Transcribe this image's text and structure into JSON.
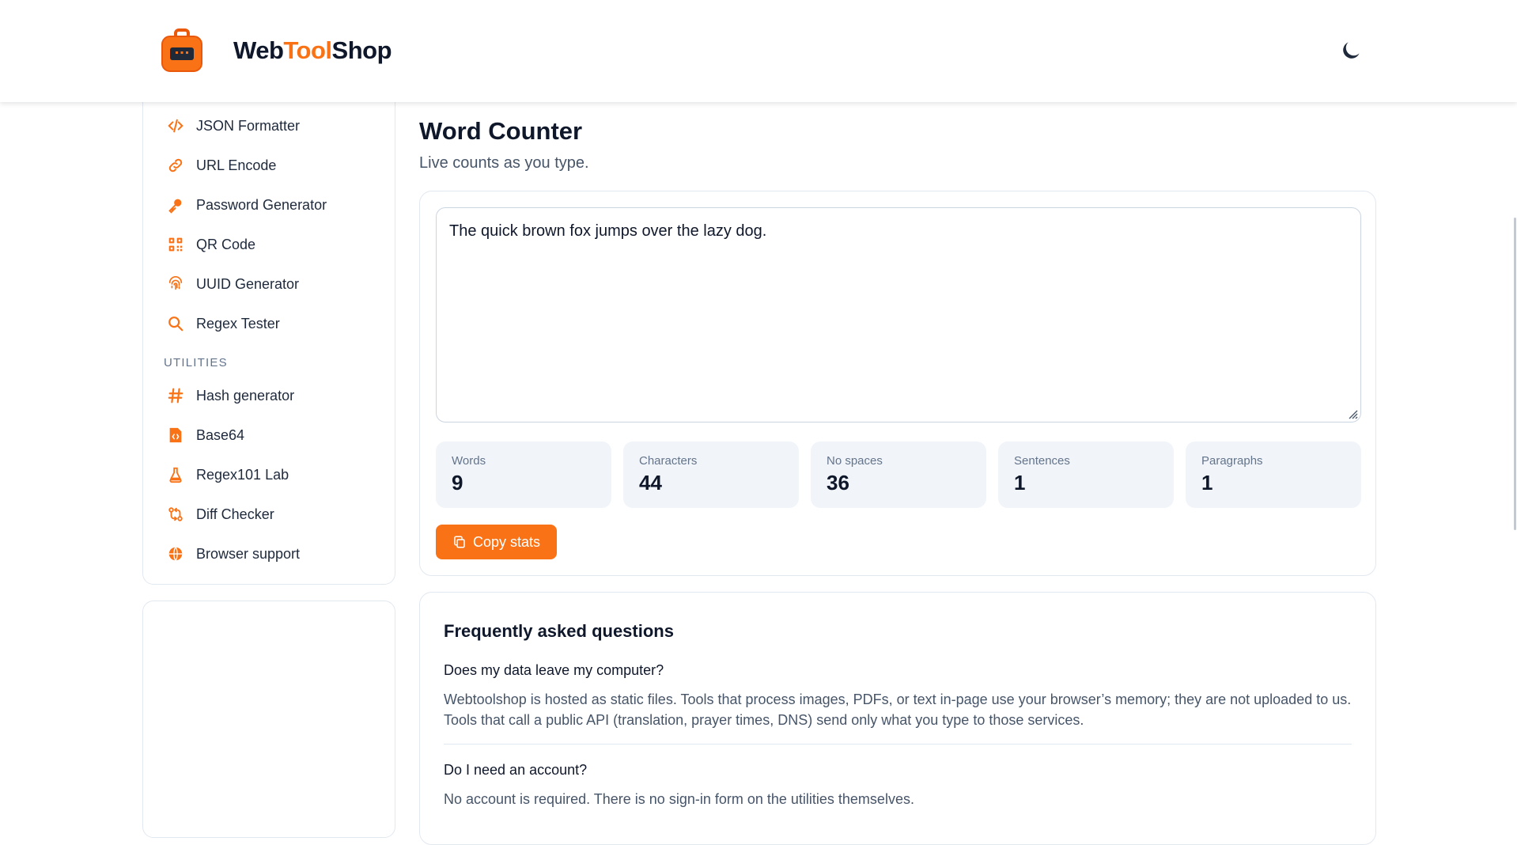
{
  "header": {
    "brand_part1": "Web",
    "brand_part2": "Tool",
    "brand_part3": "Shop",
    "theme_toggle_icon": "moon-icon"
  },
  "sidebar": {
    "items_top": [
      {
        "label": "JSON Formatter",
        "icon": "code-icon"
      },
      {
        "label": "URL Encode",
        "icon": "link-icon"
      },
      {
        "label": "Password Generator",
        "icon": "key-icon"
      },
      {
        "label": "QR Code",
        "icon": "qr-code-icon"
      },
      {
        "label": "UUID Generator",
        "icon": "fingerprint-icon"
      },
      {
        "label": "Regex Tester",
        "icon": "search-icon"
      }
    ],
    "section_label": "UTILITIES",
    "items_utilities": [
      {
        "label": "Hash generator",
        "icon": "hash-icon"
      },
      {
        "label": "Base64",
        "icon": "file-code-icon"
      },
      {
        "label": "Regex101 Lab",
        "icon": "flask-icon"
      },
      {
        "label": "Diff Checker",
        "icon": "git-compare-icon"
      },
      {
        "label": "Browser support",
        "icon": "globe-icon"
      }
    ]
  },
  "main": {
    "title": "Word Counter",
    "subtitle": "Live counts as you type.",
    "textarea_value": "The quick brown fox jumps over the lazy dog.",
    "stats": [
      {
        "label": "Words",
        "value": "9"
      },
      {
        "label": "Characters",
        "value": "44"
      },
      {
        "label": "No spaces",
        "value": "36"
      },
      {
        "label": "Sentences",
        "value": "1"
      },
      {
        "label": "Paragraphs",
        "value": "1"
      }
    ],
    "copy_button_label": "Copy stats"
  },
  "faq": {
    "title": "Frequently asked questions",
    "items": [
      {
        "q": "Does my data leave my computer?",
        "a": "Webtoolshop is hosted as static files. Tools that process images, PDFs, or text in-page use your browser’s memory; they are not uploaded to us. Tools that call a public API (translation, prayer times, DNS) send only what you type to those services."
      },
      {
        "q": "Do I need an account?",
        "a": "No account is required. There is no sign-in form on the utilities themselves."
      }
    ]
  },
  "colors": {
    "accent": "#f97316",
    "text": "#0f172a",
    "muted": "#475569",
    "stat_bg": "#f1f5f9",
    "border": "#e2e8f0"
  }
}
